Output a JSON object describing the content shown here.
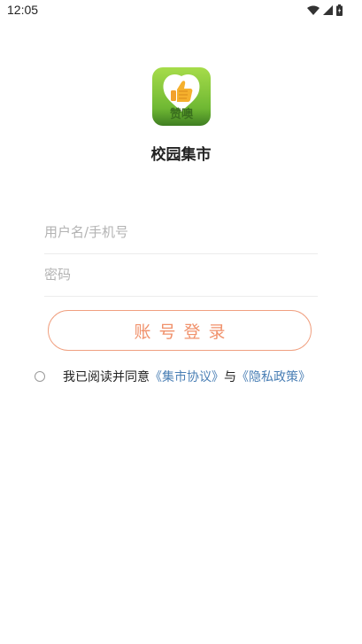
{
  "status_bar": {
    "time": "12:05",
    "icons": [
      "wifi-icon",
      "cell-signal-icon",
      "battery-icon"
    ]
  },
  "app": {
    "logo_icon": "thumbs-up-logo",
    "logo_text": "赞噢",
    "name": "校园集市"
  },
  "form": {
    "username_placeholder": "用户名/手机号",
    "password_placeholder": "密码",
    "login_label": "账号登录"
  },
  "agreement": {
    "prefix": "我已阅读并同意",
    "market_link": "《集市协议》",
    "conjunction": "与",
    "privacy_link": "《隐私政策》"
  },
  "colors": {
    "accent": "#f0916b",
    "link": "#4a7fb5",
    "logo_green": "#7cc53d"
  }
}
